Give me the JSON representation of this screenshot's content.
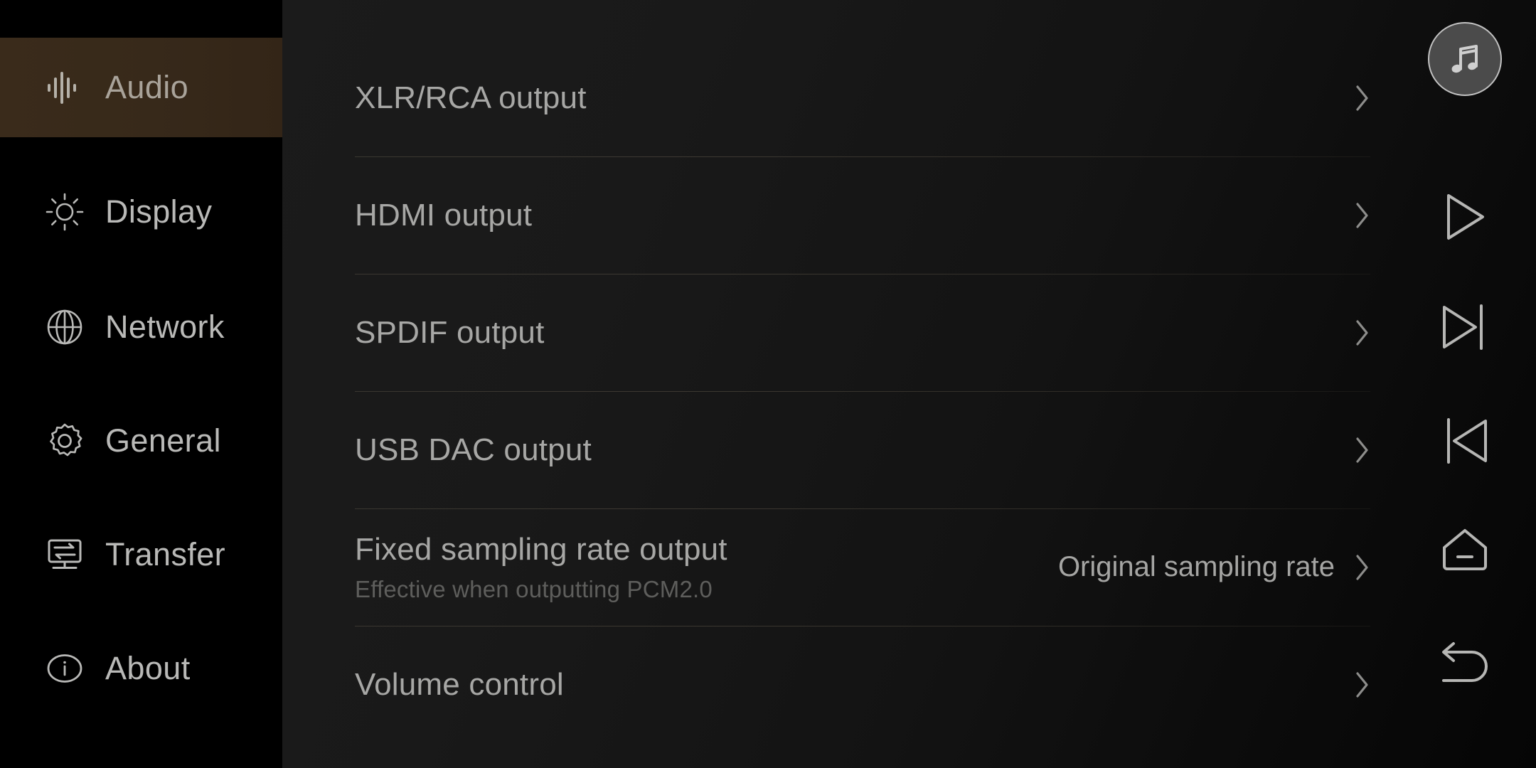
{
  "app": {
    "screen_title": "Audio",
    "background_color": "#000000",
    "accent_highlight_color": "#37291a",
    "text_primary_color": "#a7a7a5",
    "text_secondary_color": "#5e5e5c"
  },
  "sidebar": {
    "items": [
      {
        "label": "Audio",
        "icon": "audio-waveform-icon",
        "active": true
      },
      {
        "label": "Display",
        "icon": "brightness-sun-icon",
        "active": false
      },
      {
        "label": "Network",
        "icon": "globe-icon",
        "active": false
      },
      {
        "label": "General",
        "icon": "gear-icon",
        "active": false
      },
      {
        "label": "Transfer",
        "icon": "transfer-monitor-icon",
        "active": false
      },
      {
        "label": "About",
        "icon": "info-circle-icon",
        "active": false
      }
    ]
  },
  "main": {
    "rows": [
      {
        "title": "XLR/RCA output",
        "subtitle": "",
        "value": "",
        "chevron": "chevron-right-icon"
      },
      {
        "title": "HDMI output",
        "subtitle": "",
        "value": "",
        "chevron": "chevron-right-icon"
      },
      {
        "title": "SPDIF output",
        "subtitle": "",
        "value": "",
        "chevron": "chevron-right-icon"
      },
      {
        "title": "USB DAC output",
        "subtitle": "",
        "value": "",
        "chevron": "chevron-right-icon"
      },
      {
        "title": "Fixed sampling rate output",
        "subtitle": "Effective when outputting PCM2.0",
        "value": "Original sampling rate",
        "chevron": "chevron-right-icon"
      },
      {
        "title": "Volume control",
        "subtitle": "",
        "value": "",
        "chevron": "chevron-right-icon"
      }
    ]
  },
  "rail": {
    "buttons": [
      {
        "name": "now-playing-button",
        "icon": "music-note-icon"
      },
      {
        "name": "play-button",
        "icon": "play-icon"
      },
      {
        "name": "next-track-button",
        "icon": "next-track-icon"
      },
      {
        "name": "previous-track-button",
        "icon": "previous-track-icon"
      },
      {
        "name": "home-button",
        "icon": "home-icon"
      },
      {
        "name": "back-button",
        "icon": "back-arrow-icon"
      }
    ]
  }
}
